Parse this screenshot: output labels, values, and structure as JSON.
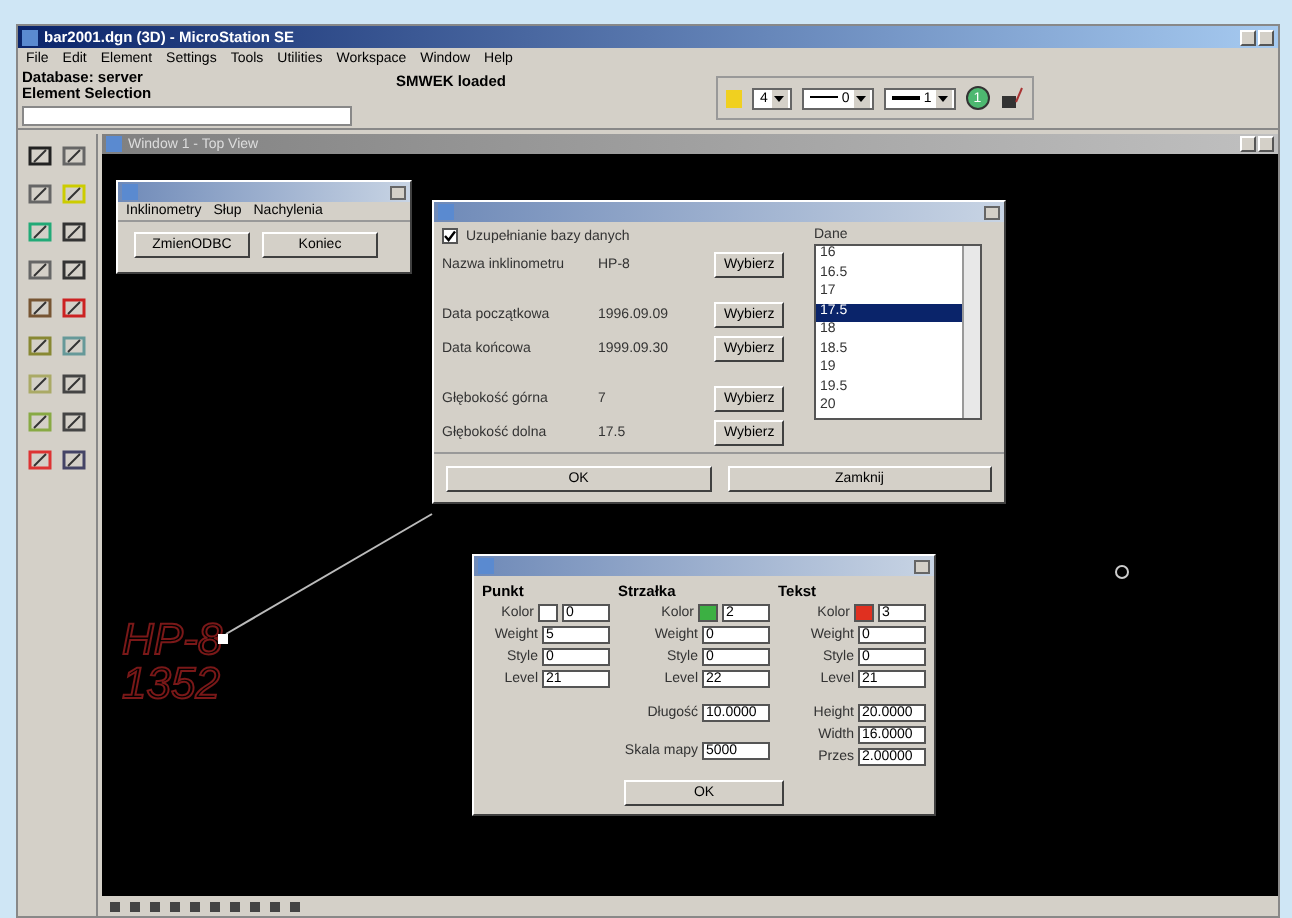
{
  "window": {
    "title": "bar2001.dgn (3D) - MicroStation SE"
  },
  "menu": [
    "File",
    "Edit",
    "Element",
    "Settings",
    "Tools",
    "Utilities",
    "Workspace",
    "Window",
    "Help"
  ],
  "status": {
    "lines": [
      "Database: server",
      "Element Selection"
    ],
    "message": "SMWEK loaded"
  },
  "attributes": {
    "color_value": "4",
    "style_value": "0",
    "weight_value": "1",
    "badge": "1"
  },
  "view": {
    "title": "Window 1 - Top View"
  },
  "app_dialog": {
    "menu": [
      "Inklinometry",
      "Słup",
      "Nachylenia"
    ],
    "buttons": [
      "ZmienODBC",
      "Koniec"
    ]
  },
  "data_dialog": {
    "checkbox": {
      "label": "Uzupełnianie bazy danych",
      "checked": true
    },
    "fields": [
      {
        "label": "Nazwa inklinometru",
        "value": "HP-8",
        "button": "Wybierz"
      },
      {
        "label": "Data początkowa",
        "value": "1996.09.09",
        "button": "Wybierz"
      },
      {
        "label": "Data końcowa",
        "value": "1999.09.30",
        "button": "Wybierz"
      },
      {
        "label": "Głębokość górna",
        "value": "7",
        "button": "Wybierz"
      },
      {
        "label": "Głębokość dolna",
        "value": "17.5",
        "button": "Wybierz"
      }
    ],
    "list_label": "Dane",
    "list": [
      {
        "text": "16",
        "selected": false
      },
      {
        "text": "16.5",
        "selected": false
      },
      {
        "text": "17",
        "selected": false
      },
      {
        "text": "17.5",
        "selected": true
      },
      {
        "text": "18",
        "selected": false
      },
      {
        "text": "18.5",
        "selected": false
      },
      {
        "text": "19",
        "selected": false
      },
      {
        "text": "19.5",
        "selected": false
      },
      {
        "text": "20",
        "selected": false
      }
    ],
    "buttons": [
      "OK",
      "Zamknij"
    ]
  },
  "symbol_dialog": {
    "groups": [
      {
        "title": "Punkt",
        "rows": [
          {
            "label": "Kolor",
            "value": "0",
            "color": "#ffffff"
          },
          {
            "label": "Weight",
            "value": "5"
          },
          {
            "label": "Style",
            "value": "0"
          },
          {
            "label": "Level",
            "value": "21"
          }
        ]
      },
      {
        "title": "Strzałka",
        "rows": [
          {
            "label": "Kolor",
            "value": "2",
            "color": "#3cb043"
          },
          {
            "label": "Weight",
            "value": "0"
          },
          {
            "label": "Style",
            "value": "0"
          },
          {
            "label": "Level",
            "value": "22"
          }
        ],
        "extra": [
          {
            "label": "Długość",
            "value": "10.0000"
          },
          {
            "label": "Skala mapy",
            "value": "5000"
          }
        ]
      },
      {
        "title": "Tekst",
        "rows": [
          {
            "label": "Kolor",
            "value": "3",
            "color": "#e03020"
          },
          {
            "label": "Weight",
            "value": "0"
          },
          {
            "label": "Style",
            "value": "0"
          },
          {
            "label": "Level",
            "value": "21"
          }
        ],
        "extra": [
          {
            "label": "Height",
            "value": "20.0000"
          },
          {
            "label": "Width",
            "value": "16.0000"
          },
          {
            "label": "Przes",
            "value": "2.00000"
          }
        ]
      }
    ],
    "button": "OK"
  },
  "canvas": {
    "labels": [
      "HP-8",
      "1352"
    ]
  }
}
